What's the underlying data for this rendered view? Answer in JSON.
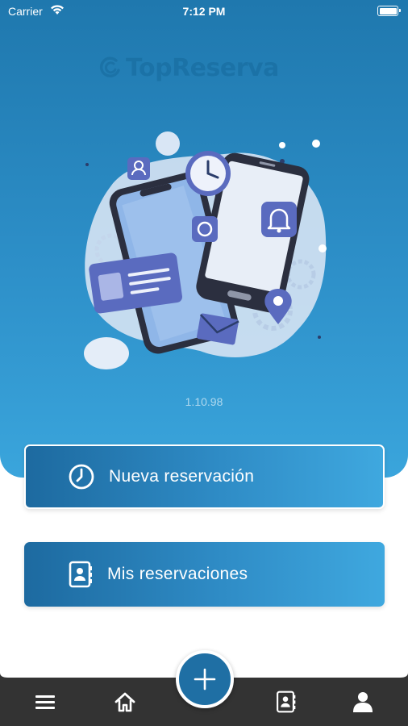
{
  "status_bar": {
    "carrier": "Carrier",
    "time": "7:12 PM"
  },
  "app": {
    "logo_text": "TopReserva",
    "version": "1.10.98"
  },
  "actions": {
    "new_reservation": {
      "label": "Nueva reservación",
      "icon": "clock-icon"
    },
    "my_reservations": {
      "label": "Mis reservaciones",
      "icon": "contact-book-icon"
    }
  },
  "tab_bar": {
    "items": [
      {
        "name": "menu",
        "icon": "hamburger-menu-icon"
      },
      {
        "name": "home",
        "icon": "home-icon"
      },
      {
        "name": "add",
        "icon": "plus-icon"
      },
      {
        "name": "reservations",
        "icon": "contact-book-icon"
      },
      {
        "name": "profile",
        "icon": "user-icon"
      }
    ]
  },
  "colors": {
    "primary": "#1f78ae",
    "accent": "#3aa5dc",
    "tab_bar": "#333333",
    "fab": "#1f6fa4"
  }
}
